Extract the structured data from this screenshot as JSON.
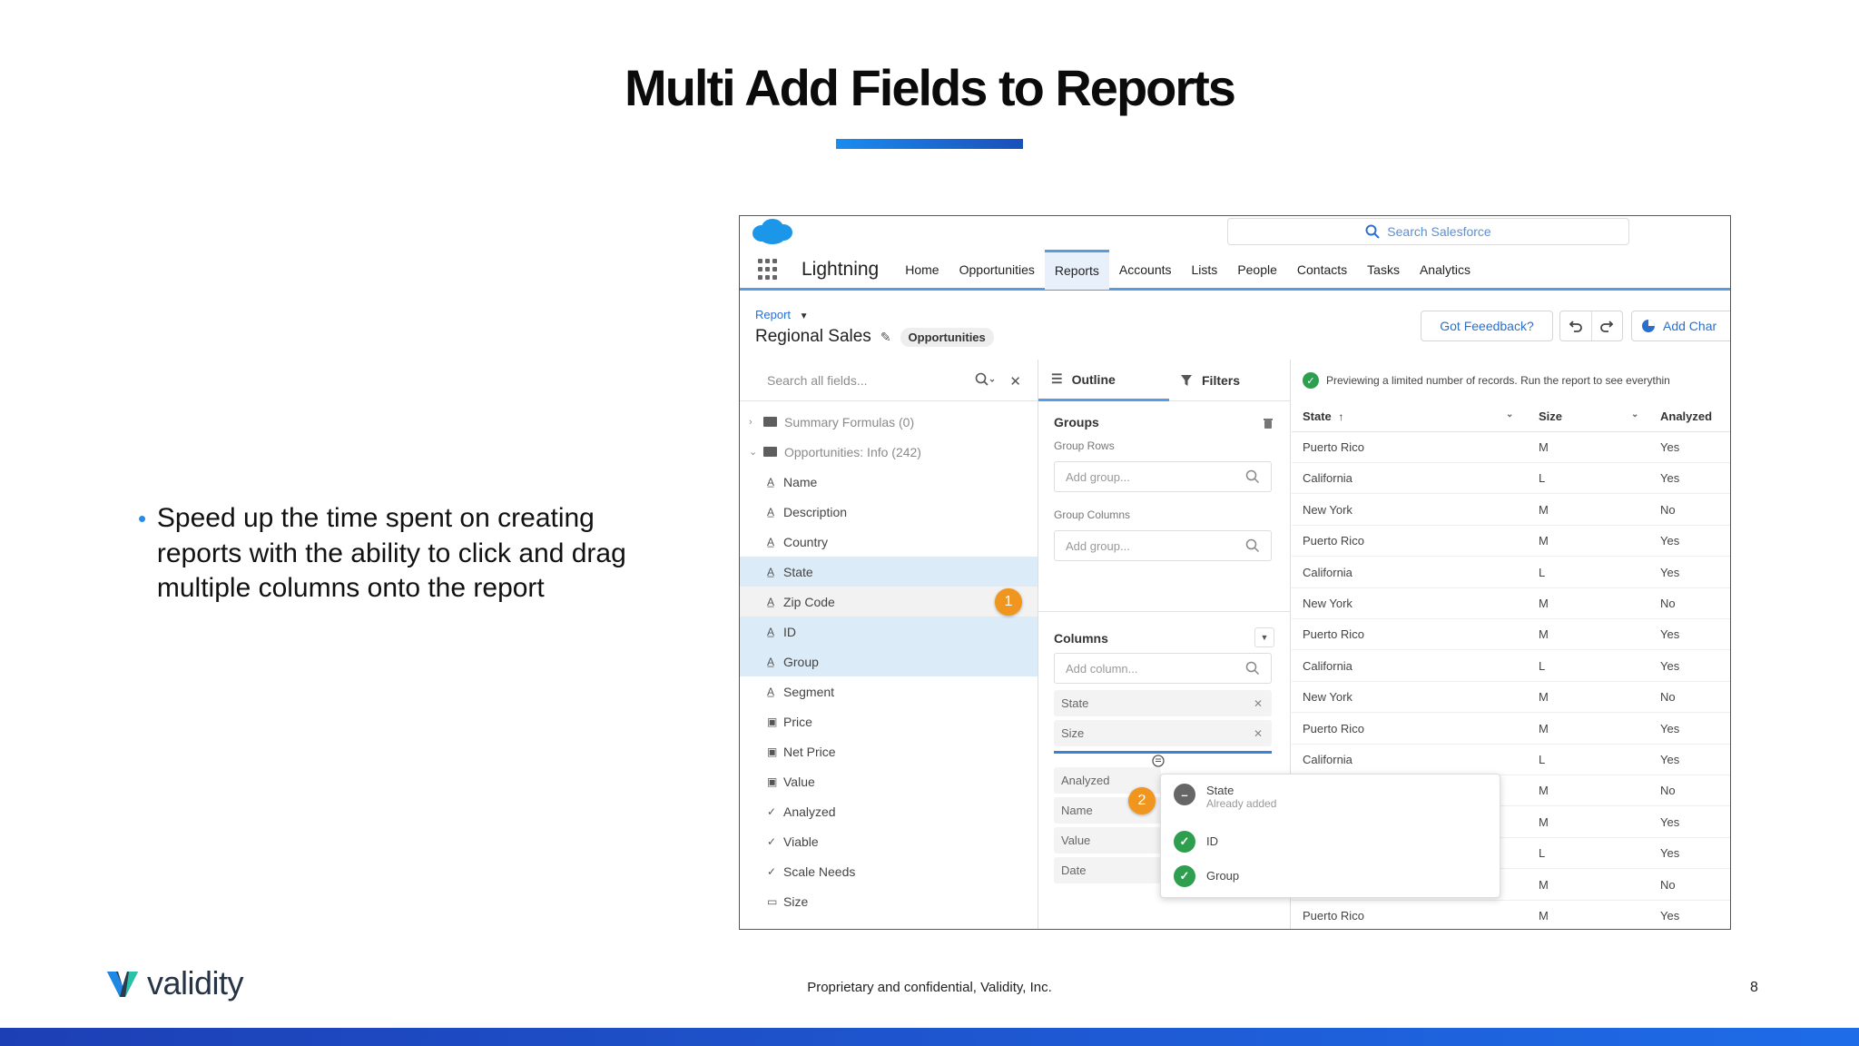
{
  "slide": {
    "title": "Multi Add Fields to Reports",
    "bullet": "Speed up the time spent on creating reports with the ability to click and drag multiple columns onto the report",
    "footer_note": "Proprietary and confidential, Validity, Inc.",
    "page_number": "8",
    "logo_text": "validity",
    "accent_color": "#1a6fe0"
  },
  "app": {
    "search_placeholder": "Search Salesforce",
    "app_name": "Lightning",
    "nav": [
      "Home",
      "Opportunities",
      "Reports",
      "Accounts",
      "Lists",
      "People",
      "Contacts",
      "Tasks",
      "Analytics"
    ],
    "active_nav": "Reports",
    "report_label": "Report",
    "report_name": "Regional Sales",
    "report_type": "Opportunities",
    "feedback_label": "Got Feeedback?",
    "add_chart_label": "Add Char"
  },
  "fields_panel": {
    "search_placeholder": "Search all fields...",
    "folders": [
      "Summary Formulas (0)",
      "Opportunities: Info (242)"
    ],
    "fields": [
      {
        "label": "Name",
        "icon": "text-icon"
      },
      {
        "label": "Description",
        "icon": "text-icon"
      },
      {
        "label": "Country",
        "icon": "text-icon"
      },
      {
        "label": "State",
        "icon": "text-icon",
        "selected": true
      },
      {
        "label": "Zip Code",
        "icon": "text-icon"
      },
      {
        "label": "ID",
        "icon": "text-icon",
        "selected": true
      },
      {
        "label": "Group",
        "icon": "text-icon",
        "selected": true
      },
      {
        "label": "Segment",
        "icon": "text-icon"
      },
      {
        "label": "Price",
        "icon": "number-icon"
      },
      {
        "label": "Net Price",
        "icon": "number-icon"
      },
      {
        "label": "Value",
        "icon": "number-icon"
      },
      {
        "label": "Analyzed",
        "icon": "checkbox-icon"
      },
      {
        "label": "Viable",
        "icon": "checkbox-icon"
      },
      {
        "label": "Scale Needs",
        "icon": "checkbox-icon"
      },
      {
        "label": "Size",
        "icon": "picklist-icon"
      }
    ],
    "badge_1": "1"
  },
  "outline_panel": {
    "tab_outline": "Outline",
    "tab_filters": "Filters",
    "groups_heading": "Groups",
    "group_rows_label": "Group Rows",
    "group_rows_placeholder": "Add group...",
    "group_columns_label": "Group Columns",
    "group_columns_placeholder": "Add group...",
    "columns_heading": "Columns",
    "columns_placeholder": "Add column...",
    "columns": [
      "State",
      "Size"
    ],
    "dragged": [
      "Analyzed",
      "Name",
      "Value",
      "Date"
    ],
    "badge_2": "2"
  },
  "drag_popover": {
    "items": [
      {
        "label": "State",
        "sub": "Already added",
        "status": "minus"
      },
      {
        "label": "ID",
        "sub": "",
        "status": "check"
      },
      {
        "label": "Group",
        "sub": "",
        "status": "check"
      }
    ]
  },
  "preview": {
    "note": "Previewing a limited number of records. Run the report to see everythin",
    "headers": [
      "State",
      "Size",
      "Analyzed"
    ],
    "rows": [
      [
        "Puerto Rico",
        "M",
        "Yes"
      ],
      [
        "California",
        "L",
        "Yes"
      ],
      [
        "New York",
        "M",
        "No"
      ],
      [
        "Puerto Rico",
        "M",
        "Yes"
      ],
      [
        "California",
        "L",
        "Yes"
      ],
      [
        "New York",
        "M",
        "No"
      ],
      [
        "Puerto Rico",
        "M",
        "Yes"
      ],
      [
        "California",
        "L",
        "Yes"
      ],
      [
        "New York",
        "M",
        "No"
      ],
      [
        "Puerto Rico",
        "M",
        "Yes"
      ],
      [
        "California",
        "L",
        "Yes"
      ],
      [
        "",
        "M",
        "No"
      ],
      [
        "",
        "M",
        "Yes"
      ],
      [
        "",
        "L",
        "Yes"
      ],
      [
        "",
        "M",
        "No"
      ],
      [
        "Puerto Rico",
        "M",
        "Yes"
      ]
    ]
  }
}
